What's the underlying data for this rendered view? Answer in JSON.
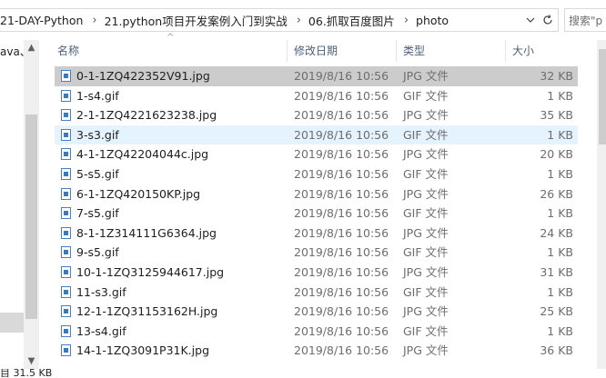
{
  "address": {
    "crumbs": [
      "21-DAY-Python",
      "21.python项目开发案例入门到实战",
      "06.抓取百度图片",
      "photo"
    ],
    "separator": "›",
    "dropdown_icon": "chevron-down-icon",
    "refresh_icon": "refresh-icon"
  },
  "search": {
    "placeholder": "搜索\"p"
  },
  "nav": {
    "items": [
      {
        "label": "ava、"
      }
    ]
  },
  "columns": {
    "name": "名称",
    "date": "修改日期",
    "type": "类型",
    "size": "大小"
  },
  "files": [
    {
      "name": "0-1-1ZQ422352V91.jpg",
      "date": "2019/8/16 10:56",
      "type": "JPG 文件",
      "size": "32 KB"
    },
    {
      "name": "1-s4.gif",
      "date": "2019/8/16 10:56",
      "type": "GIF 文件",
      "size": "1 KB"
    },
    {
      "name": "2-1-1ZQ4221623238.jpg",
      "date": "2019/8/16 10:56",
      "type": "JPG 文件",
      "size": "35 KB"
    },
    {
      "name": "3-s3.gif",
      "date": "2019/8/16 10:56",
      "type": "GIF 文件",
      "size": "1 KB"
    },
    {
      "name": "4-1-1ZQ42204044c.jpg",
      "date": "2019/8/16 10:56",
      "type": "JPG 文件",
      "size": "20 KB"
    },
    {
      "name": "5-s5.gif",
      "date": "2019/8/16 10:56",
      "type": "GIF 文件",
      "size": "1 KB"
    },
    {
      "name": "6-1-1ZQ420150KP.jpg",
      "date": "2019/8/16 10:56",
      "type": "JPG 文件",
      "size": "26 KB"
    },
    {
      "name": "7-s5.gif",
      "date": "2019/8/16 10:56",
      "type": "GIF 文件",
      "size": "1 KB"
    },
    {
      "name": "8-1-1Z314111G6364.jpg",
      "date": "2019/8/16 10:56",
      "type": "JPG 文件",
      "size": "24 KB"
    },
    {
      "name": "9-s5.gif",
      "date": "2019/8/16 10:56",
      "type": "GIF 文件",
      "size": "1 KB"
    },
    {
      "name": "10-1-1ZQ3125944617.jpg",
      "date": "2019/8/16 10:56",
      "type": "JPG 文件",
      "size": "31 KB"
    },
    {
      "name": "11-s3.gif",
      "date": "2019/8/16 10:56",
      "type": "GIF 文件",
      "size": "1 KB"
    },
    {
      "name": "12-1-1ZQ31153162H.jpg",
      "date": "2019/8/16 10:56",
      "type": "JPG 文件",
      "size": "25 KB"
    },
    {
      "name": "13-s4.gif",
      "date": "2019/8/16 10:56",
      "type": "GIF 文件",
      "size": "1 KB"
    },
    {
      "name": "14-1-1ZQ3091P31K.jpg",
      "date": "2019/8/16 10:56",
      "type": "JPG 文件",
      "size": "36 KB"
    }
  ],
  "selected_index": 0,
  "hover_index": 3,
  "status": {
    "text": "目  31.5 KB"
  },
  "colors": {
    "selected_row": "#cccccc",
    "hover_row": "#e5f3ff",
    "header_text": "#4c607a"
  }
}
